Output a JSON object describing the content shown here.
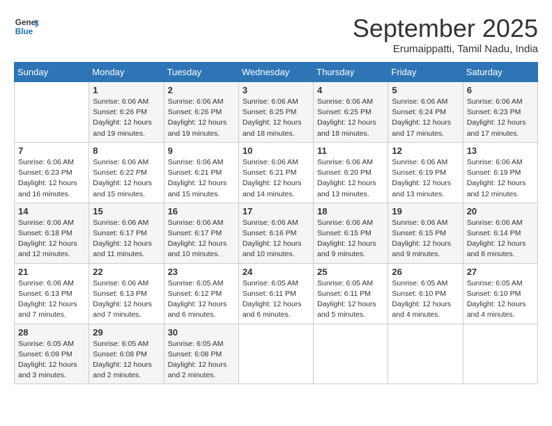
{
  "header": {
    "logo_line1": "General",
    "logo_line2": "Blue",
    "month": "September 2025",
    "location": "Erumaippatti, Tamil Nadu, India"
  },
  "weekdays": [
    "Sunday",
    "Monday",
    "Tuesday",
    "Wednesday",
    "Thursday",
    "Friday",
    "Saturday"
  ],
  "weeks": [
    [
      {
        "day": "",
        "info": ""
      },
      {
        "day": "1",
        "info": "Sunrise: 6:06 AM\nSunset: 6:26 PM\nDaylight: 12 hours\nand 19 minutes."
      },
      {
        "day": "2",
        "info": "Sunrise: 6:06 AM\nSunset: 6:26 PM\nDaylight: 12 hours\nand 19 minutes."
      },
      {
        "day": "3",
        "info": "Sunrise: 6:06 AM\nSunset: 6:25 PM\nDaylight: 12 hours\nand 18 minutes."
      },
      {
        "day": "4",
        "info": "Sunrise: 6:06 AM\nSunset: 6:25 PM\nDaylight: 12 hours\nand 18 minutes."
      },
      {
        "day": "5",
        "info": "Sunrise: 6:06 AM\nSunset: 6:24 PM\nDaylight: 12 hours\nand 17 minutes."
      },
      {
        "day": "6",
        "info": "Sunrise: 6:06 AM\nSunset: 6:23 PM\nDaylight: 12 hours\nand 17 minutes."
      }
    ],
    [
      {
        "day": "7",
        "info": "Sunrise: 6:06 AM\nSunset: 6:23 PM\nDaylight: 12 hours\nand 16 minutes."
      },
      {
        "day": "8",
        "info": "Sunrise: 6:06 AM\nSunset: 6:22 PM\nDaylight: 12 hours\nand 15 minutes."
      },
      {
        "day": "9",
        "info": "Sunrise: 6:06 AM\nSunset: 6:21 PM\nDaylight: 12 hours\nand 15 minutes."
      },
      {
        "day": "10",
        "info": "Sunrise: 6:06 AM\nSunset: 6:21 PM\nDaylight: 12 hours\nand 14 minutes."
      },
      {
        "day": "11",
        "info": "Sunrise: 6:06 AM\nSunset: 6:20 PM\nDaylight: 12 hours\nand 13 minutes."
      },
      {
        "day": "12",
        "info": "Sunrise: 6:06 AM\nSunset: 6:19 PM\nDaylight: 12 hours\nand 13 minutes."
      },
      {
        "day": "13",
        "info": "Sunrise: 6:06 AM\nSunset: 6:19 PM\nDaylight: 12 hours\nand 12 minutes."
      }
    ],
    [
      {
        "day": "14",
        "info": "Sunrise: 6:06 AM\nSunset: 6:18 PM\nDaylight: 12 hours\nand 12 minutes."
      },
      {
        "day": "15",
        "info": "Sunrise: 6:06 AM\nSunset: 6:17 PM\nDaylight: 12 hours\nand 11 minutes."
      },
      {
        "day": "16",
        "info": "Sunrise: 6:06 AM\nSunset: 6:17 PM\nDaylight: 12 hours\nand 10 minutes."
      },
      {
        "day": "17",
        "info": "Sunrise: 6:06 AM\nSunset: 6:16 PM\nDaylight: 12 hours\nand 10 minutes."
      },
      {
        "day": "18",
        "info": "Sunrise: 6:06 AM\nSunset: 6:15 PM\nDaylight: 12 hours\nand 9 minutes."
      },
      {
        "day": "19",
        "info": "Sunrise: 6:06 AM\nSunset: 6:15 PM\nDaylight: 12 hours\nand 9 minutes."
      },
      {
        "day": "20",
        "info": "Sunrise: 6:06 AM\nSunset: 6:14 PM\nDaylight: 12 hours\nand 8 minutes."
      }
    ],
    [
      {
        "day": "21",
        "info": "Sunrise: 6:06 AM\nSunset: 6:13 PM\nDaylight: 12 hours\nand 7 minutes."
      },
      {
        "day": "22",
        "info": "Sunrise: 6:06 AM\nSunset: 6:13 PM\nDaylight: 12 hours\nand 7 minutes."
      },
      {
        "day": "23",
        "info": "Sunrise: 6:05 AM\nSunset: 6:12 PM\nDaylight: 12 hours\nand 6 minutes."
      },
      {
        "day": "24",
        "info": "Sunrise: 6:05 AM\nSunset: 6:11 PM\nDaylight: 12 hours\nand 6 minutes."
      },
      {
        "day": "25",
        "info": "Sunrise: 6:05 AM\nSunset: 6:11 PM\nDaylight: 12 hours\nand 5 minutes."
      },
      {
        "day": "26",
        "info": "Sunrise: 6:05 AM\nSunset: 6:10 PM\nDaylight: 12 hours\nand 4 minutes."
      },
      {
        "day": "27",
        "info": "Sunrise: 6:05 AM\nSunset: 6:10 PM\nDaylight: 12 hours\nand 4 minutes."
      }
    ],
    [
      {
        "day": "28",
        "info": "Sunrise: 6:05 AM\nSunset: 6:09 PM\nDaylight: 12 hours\nand 3 minutes."
      },
      {
        "day": "29",
        "info": "Sunrise: 6:05 AM\nSunset: 6:08 PM\nDaylight: 12 hours\nand 2 minutes."
      },
      {
        "day": "30",
        "info": "Sunrise: 6:05 AM\nSunset: 6:08 PM\nDaylight: 12 hours\nand 2 minutes."
      },
      {
        "day": "",
        "info": ""
      },
      {
        "day": "",
        "info": ""
      },
      {
        "day": "",
        "info": ""
      },
      {
        "day": "",
        "info": ""
      }
    ]
  ]
}
